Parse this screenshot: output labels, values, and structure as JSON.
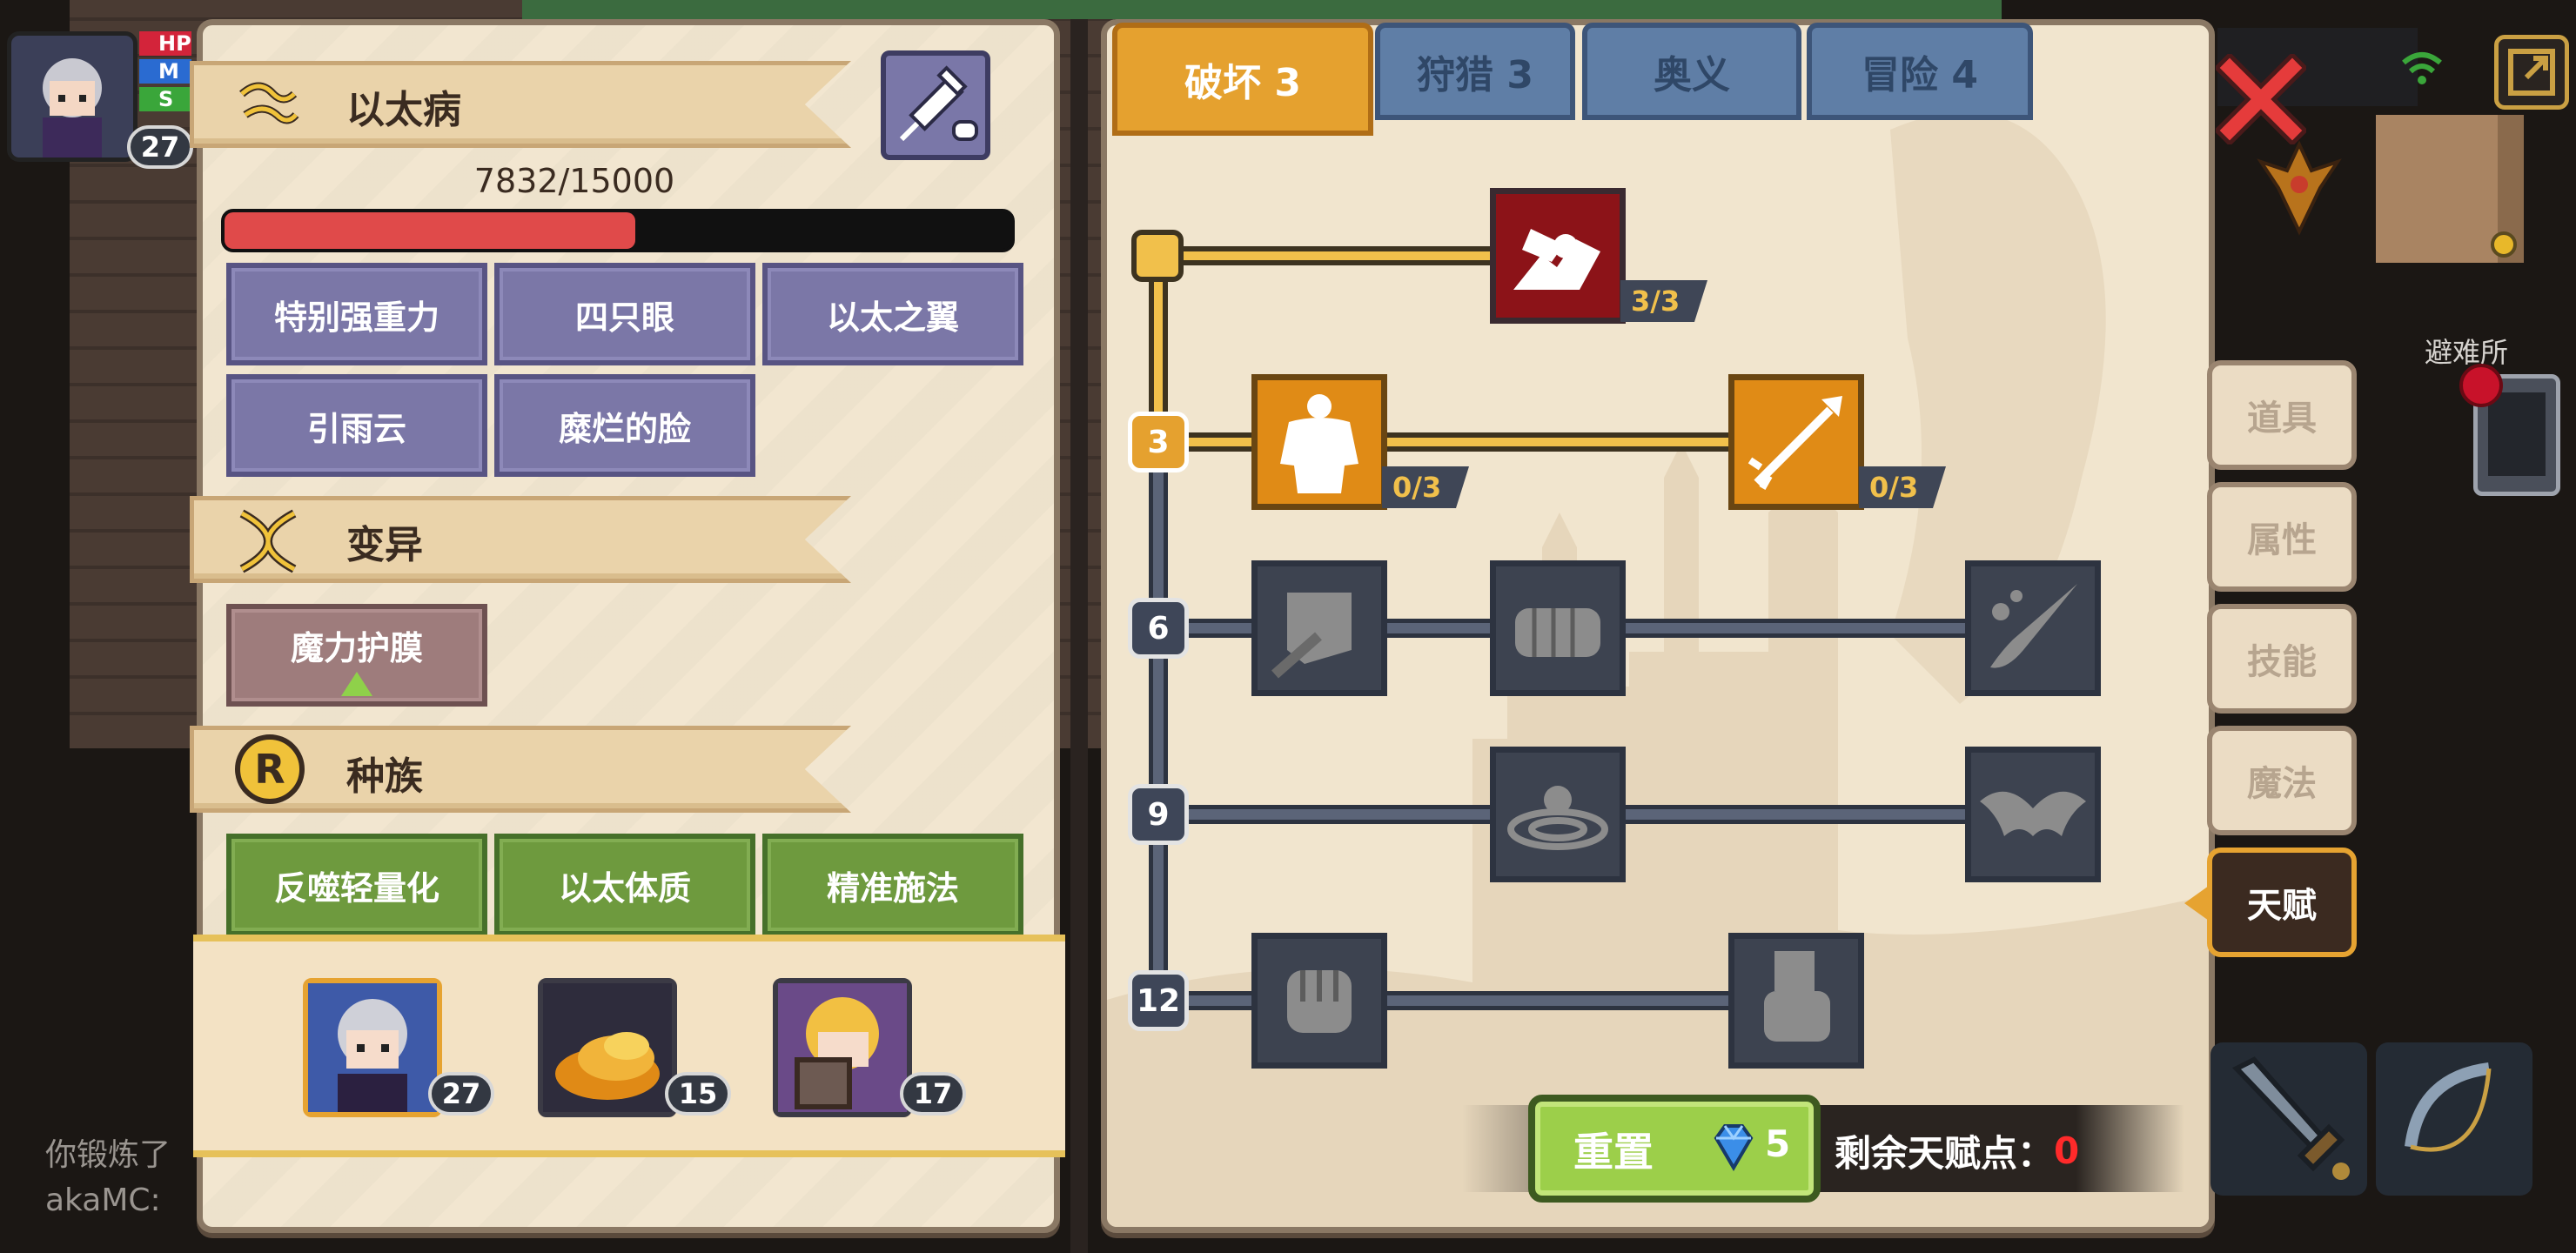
{
  "hud": {
    "player_level": "27",
    "bars": [
      "HP",
      "M",
      "S"
    ]
  },
  "disease": {
    "title": "以太病",
    "progress_text": "7832/15000",
    "progress": 0.522,
    "traits": [
      "特别强重力",
      "四只眼",
      "以太之翼",
      "引雨云",
      "糜烂的脸"
    ]
  },
  "mutation": {
    "title": "变异",
    "traits": [
      "魔力护膜"
    ]
  },
  "race": {
    "title": "种族",
    "traits": [
      "反噬轻量化",
      "以太体质",
      "精准施法"
    ]
  },
  "party": [
    {
      "name": "hero-portrait",
      "level": "27"
    },
    {
      "name": "fire-creature-portrait",
      "level": "15"
    },
    {
      "name": "blonde-ally-portrait",
      "level": "17"
    }
  ],
  "chat": {
    "line1": "你锻炼了",
    "line2": "akaMC:"
  },
  "talent_tabs": [
    {
      "label": "破坏 3",
      "active": true
    },
    {
      "label": "狩猎 3",
      "active": false
    },
    {
      "label": "奥义",
      "active": false
    },
    {
      "label": "冒险 4",
      "active": false
    }
  ],
  "tiers": [
    "3",
    "6",
    "9",
    "12"
  ],
  "talent_nodes": [
    {
      "icon": "arm-wrestle-icon",
      "count": "3/3",
      "state": "maxed"
    },
    {
      "icon": "muscle-body-icon",
      "count": "0/3",
      "state": "available"
    },
    {
      "icon": "arrow-icon",
      "count": "0/3",
      "state": "available"
    }
  ],
  "reset": {
    "label": "重置",
    "cost": "5",
    "remaining_label": "剩余天赋点：",
    "remaining_value": "0"
  },
  "shelter_label": "避难所",
  "side_menu": [
    "道具",
    "属性",
    "技能",
    "魔法",
    "天赋"
  ],
  "side_menu_active": "天赋",
  "colors": {
    "progress_fill": "#e04a4a",
    "active_tab": "#e5a12f",
    "close_red": "#e53b3b",
    "remaining_zero": "#ff2a2a",
    "gem_blue": "#3b8ee8"
  }
}
